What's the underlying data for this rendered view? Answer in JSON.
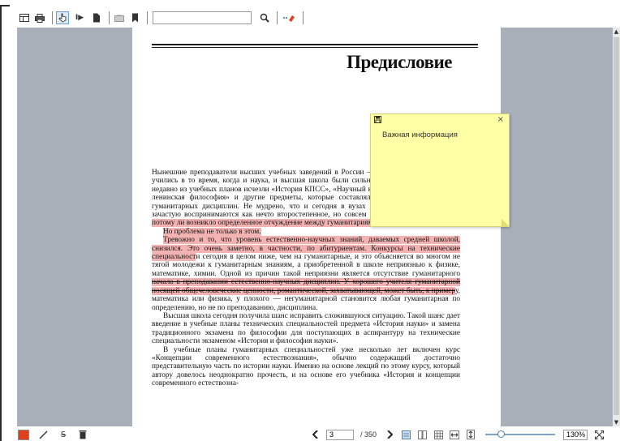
{
  "toolbar": {
    "search": {
      "value": "",
      "placeholder": ""
    },
    "icons": [
      "thumbnails-icon",
      "print-icon",
      "select-tool-icon",
      "text-select-icon",
      "document-icon",
      "annotation-icon",
      "bookmark-icon",
      "search-icon",
      "highlight-icon"
    ]
  },
  "document": {
    "heading": "Предисловие",
    "paragraphs": [
      {
        "segments": [
          {
            "text": "Нынешние преподаватели высших учебных заведений в России — все те, кто в своем сами учились в то время, когда и наука, и высшая школа были сильно политизированы. Совсем недавно из учебных планов исчезли «История КПСС», «Научный коммунизм», «Марксистско-ленинская философия» и другие предметы, которые составляли большую основу цикла гуманитарных дисциплин. Не мудрено, что и сегодня в вузах гуманитарные дисциплины зачастую воспринимаются как нечто второстепенное, но совсем ",
            "style": ""
          },
          {
            "text": "не относящееся к делу. Не потому ли возникло определенное отчуждение между гуманитариями и «технарями»?",
            "style": "hl"
          }
        ]
      },
      {
        "indent": true,
        "segments": [
          {
            "text": "Но проблема не только в этом.",
            "style": "hl"
          }
        ]
      },
      {
        "indent": true,
        "segments": [
          {
            "text": "Тревожно и то, что уровень естественно-научных знаний, даваемых средней школой, снизился. Это очень заметно, в частности, по абитуриентам. Конкурсы на технические специальност",
            "style": "hl"
          },
          {
            "text": "и сегодня в целом ниже, чем на гуманитарные, и это объясняется во многом не тягой молодежи к гуманитарным знаниям, а приобретенной в школе неприязнью к физике, математике, химии. Одной из причин такой неприязни является отсутствие гуманитарного ",
            "style": ""
          },
          {
            "text": "начала в преподавании естественно-научных дисциплин. У хорошего учителя гуманитарной носящей общечеловеческие ценности, романтической, захватывающей, может быть, к пример",
            "style": "hl st"
          },
          {
            "text": "у, математика или физика, у плохого — негуманитарной становится любая гуманитарная по определению, но не по преподаванию, дисциплина.",
            "style": ""
          }
        ]
      },
      {
        "indent": true,
        "segments": [
          {
            "text": "Высшая школа сегодня получила шанс исправить сложившуюся ситуацию. Такой шанс дает введение в учебные планы технических специальностей предмета «История науки» и замена традиционного экзамена по философии для поступающих в аспирантуру на технические специальности экзаменом «История и философия науки».",
            "style": ""
          }
        ]
      },
      {
        "indent": true,
        "segments": [
          {
            "text": "В учебные планы гуманитарных специальностей уже несколько лет включен курс «Концепции современного естествознания», обычно содержащий достаточно представительную часть по истории науки. Именно на основе лекций по этому курсу, который автору довелось неоднократно прочесть, и на основе его учебника «История и концепции современного естествозна-",
            "style": ""
          }
        ]
      }
    ]
  },
  "note": {
    "text": "Важная информация",
    "icons": [
      "save-icon",
      "close-icon"
    ]
  },
  "bottombar": {
    "current_page": "3",
    "total_pages": "/ 350",
    "zoom": "130%",
    "zoom_level": 0.18,
    "annotation_color": "#e0401c",
    "icons": [
      "color-picker-icon",
      "pen-icon",
      "strikethrough-icon",
      "delete-icon",
      "prev-page-icon",
      "next-page-icon",
      "single-page-icon",
      "two-page-icon",
      "grid-view-icon",
      "fit-width-icon",
      "fit-height-icon",
      "fullscreen-icon"
    ]
  }
}
